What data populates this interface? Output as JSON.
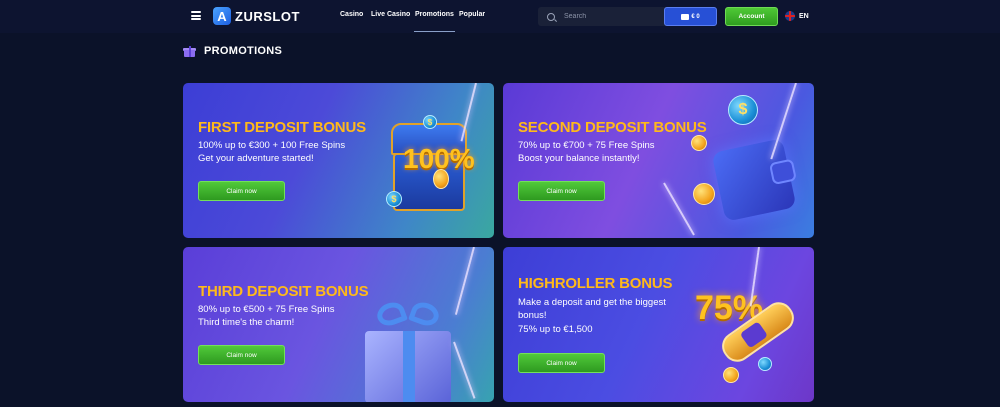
{
  "header": {
    "logo_letter": "A",
    "logo_text": "ZURSLOT",
    "nav": [
      "Casino",
      "Live Casino",
      "Promotions",
      "Popular"
    ],
    "search_placeholder": "Search",
    "wallet_balance": "€ 0",
    "account_label": "Account",
    "language": "EN"
  },
  "page": {
    "title": "PROMOTIONS"
  },
  "promotions": [
    {
      "title": "FIRST DEPOSIT BONUS",
      "line1": "100% up to €300 + 100 Free Spins",
      "line2": "Get your adventure started!",
      "cta": "Claim now",
      "art_text": "100%"
    },
    {
      "title": "SECOND DEPOSIT BONUS",
      "line1": "70% up to €700 + 75 Free Spins",
      "line2": "Boost your balance instantly!",
      "cta": "Claim now"
    },
    {
      "title": "THIRD DEPOSIT BONUS",
      "line1": "80% up to €500 + 75 Free Spins",
      "line2": "Third time's the charm!",
      "cta": "Claim now"
    },
    {
      "title": "HIGHROLLER BONUS",
      "line1": "Make a deposit and get the biggest",
      "line2": "bonus!",
      "line3": "75% up to €1,500",
      "cta": "Claim now",
      "art_text": "75%"
    }
  ],
  "coin_symbol": "$",
  "colors": {
    "background": "#0b1229",
    "accent_title": "#ffb91a",
    "claim_button": "#3eb12a",
    "wallet_button": "#2750d6"
  }
}
